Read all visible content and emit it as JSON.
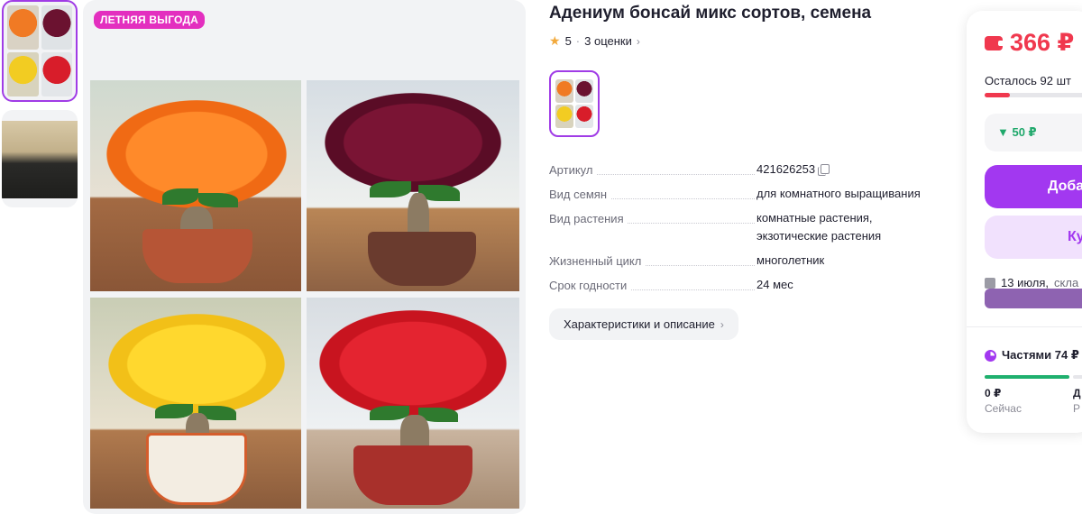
{
  "gallery": {
    "promo_badge": "ЛЕТНЯЯ ВЫГОДА",
    "thumbnails": [
      "adenium-collage",
      "seeds-photo"
    ]
  },
  "product": {
    "title": "Адениум бонсай микс сортов, семена",
    "rating": "5",
    "reviews_label": "3 оценки",
    "specs": [
      {
        "key": "Артикул",
        "value": "421626253"
      },
      {
        "key": "Вид семян",
        "value": "для комнатного выращивания"
      },
      {
        "key": "Вид растения",
        "value": "комнатные растения, экзотические растения"
      },
      {
        "key": "Жизненный цикл",
        "value": "многолетник"
      },
      {
        "key": "Срок годности",
        "value": "24 мес"
      }
    ],
    "characteristics_button": "Характеристики и описание"
  },
  "buy_card": {
    "price": "366 ₽",
    "stock_text": "Осталось 92 шт",
    "stock_level": 0.2,
    "discount": "▼ 50 ₽",
    "add_button": "Доба",
    "buy_button": "Ку",
    "delivery_date": "13 июля,",
    "delivery_rest": "скла",
    "installments": "Частями 74 ₽",
    "pay_now_amount": "0 ₽",
    "pay_now_label": "Сейчас",
    "pay_next_amount": "Д",
    "pay_next_label": "Р"
  },
  "colors": {
    "accent": "#a238f0",
    "price": "#f0384e",
    "promo": "#e32fbf",
    "discount": "#1fa86b"
  }
}
